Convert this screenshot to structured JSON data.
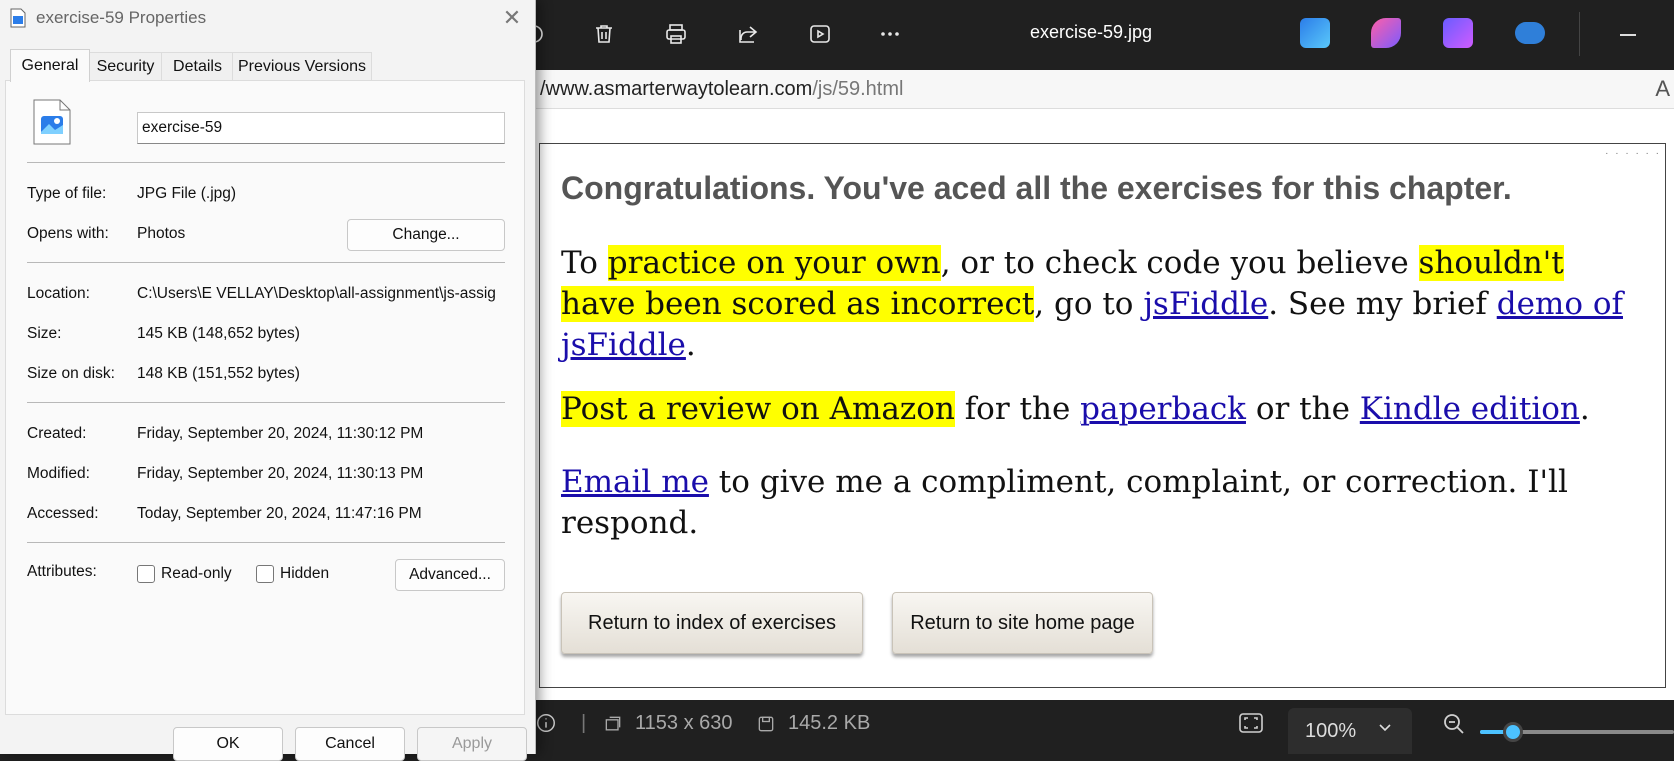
{
  "viewer": {
    "document_title": "exercise-59.jpg",
    "toolbar_icons": [
      "rotate-icon",
      "trash-icon",
      "print-icon",
      "share-icon",
      "slideshow-icon",
      "more-icon"
    ],
    "app_icons": [
      "photos-icon",
      "clipchamp-icon",
      "video-editor-icon",
      "onedrive-icon"
    ],
    "status": {
      "dimensions": "1153 x 630",
      "file_size": "145.2 KB",
      "zoom": "100%",
      "zoom_level_fraction": 0.15
    }
  },
  "screenshot_content": {
    "url_prefix": "/www.asmarterwaytolearn.com",
    "url_path": "/js/59.html",
    "aa": "A",
    "dots": "· · · · · ·",
    "heading": "Congratulations. You've aced all the exercises for this chapter.",
    "p1": {
      "t1": "To ",
      "h1": "practice on your own",
      "t2": ", or to check code you believe ",
      "h2": "shouldn't have been scored as incorrect",
      "t3": ", go to ",
      "l1": "jsFiddle",
      "t4": ". See my brief ",
      "l2": "demo of jsFiddle",
      "t5": "."
    },
    "p2": {
      "h1": "Post a review on Amazon",
      "t1": " for the ",
      "l1": "paperback",
      "t2": " or the ",
      "l2": "Kindle edition",
      "t3": "."
    },
    "p3": {
      "l1": "Email me",
      "t1": " to give me a compliment, complaint, or correction. I'll respond."
    },
    "buttons": {
      "index": "Return to index of exercises",
      "home": "Return to site home page"
    }
  },
  "dialog": {
    "title": "exercise-59 Properties",
    "tabs": [
      "General",
      "Security",
      "Details",
      "Previous Versions"
    ],
    "file_name": "exercise-59",
    "type_label": "Type of file:",
    "type_value": "JPG File (.jpg)",
    "opens_label": "Opens with:",
    "opens_value": "Photos",
    "change_button": "Change...",
    "location_label": "Location:",
    "location_value": "C:\\Users\\E VELLAY\\Desktop\\all-assignment\\js-assig",
    "size_label": "Size:",
    "size_value": "145 KB (148,652 bytes)",
    "size_disk_label": "Size on disk:",
    "size_disk_value": "148 KB (151,552 bytes)",
    "created_label": "Created:",
    "created_value": "Friday, September 20, 2024, 11:30:12 PM",
    "modified_label": "Modified:",
    "modified_value": "Friday, September 20, 2024, 11:30:13 PM",
    "accessed_label": "Accessed:",
    "accessed_value": "Today, September 20, 2024, 11:47:16 PM",
    "attributes_label": "Attributes:",
    "readonly_label": "Read-only",
    "readonly_checked": false,
    "hidden_label": "Hidden",
    "hidden_checked": false,
    "advanced_button": "Advanced...",
    "ok_button": "OK",
    "cancel_button": "Cancel",
    "apply_button": "Apply"
  },
  "colors": {
    "viewer_bg": "#202020",
    "highlight": "#ffff00",
    "link": "#1a0dab",
    "accent": "#4cc2ff"
  }
}
